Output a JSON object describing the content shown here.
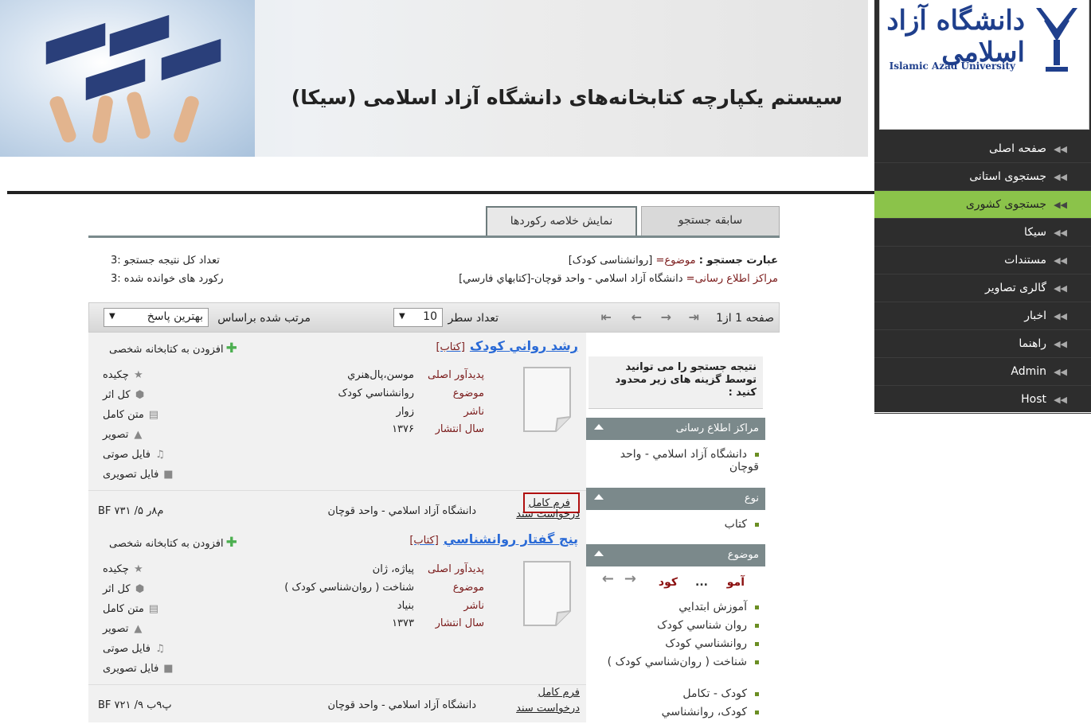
{
  "banner": {
    "title": "سیستم یکپارچه کتابخانه‌های دانشگاه آزاد اسلامی (سیکا)"
  },
  "logo": {
    "name_fa": "دانشگاه آزاد اسلامی",
    "name_en": "Islamic Azad University"
  },
  "menu": [
    {
      "label": "صفحه اصلی"
    },
    {
      "label": "جستجوی استانی"
    },
    {
      "label": "جستجوی کشوری"
    },
    {
      "label": "سیکا"
    },
    {
      "label": "مستندات"
    },
    {
      "label": "گالری تصاویر"
    },
    {
      "label": "اخبار"
    },
    {
      "label": "راهنما"
    },
    {
      "label": "Admin"
    },
    {
      "label": "Host"
    }
  ],
  "tabs": {
    "history": "سابقه جستجو",
    "summary": "نمایش خلاصه رکوردها"
  },
  "search_info": {
    "phrase_label": "عبارت جستجو :",
    "subject_label": "موضوع=",
    "subject_value": "[روانشناسی کودک]",
    "centers_label": "مراکز اطلاع رسانی=",
    "centers_value": "دانشگاه آزاد اسلامي - واحد قوچان-[کتابهاي فارسي]",
    "total_label": "تعداد کل نتیجه جستجو :",
    "total_value": "3",
    "read_label": "رکورد های خوانده شده :",
    "read_value": "3"
  },
  "toolbar": {
    "page_label": "صفحه 1 از1",
    "rows_label": "تعداد سطر",
    "rows_value": "10",
    "sort_label": "مرتب شده براساس",
    "sort_value": "بهترین پاسخ"
  },
  "field_labels": {
    "author": "پدیدآور اصلی",
    "subject": "موضوع",
    "publisher": "ناشر",
    "year": "سال انتشار"
  },
  "options": [
    "چکیده",
    "کل اثر",
    "متن کامل",
    "تصویر",
    "فایل صوتی",
    "فایل تصویری"
  ],
  "add_lib": "افزودن به کتابخانه شخصی",
  "full_form": "فرم کامل",
  "request_doc": "درخواست سند",
  "records": [
    {
      "title": "رشد رواني کودک",
      "type": "[کتاب]",
      "author": "موسن،پال‌هنري",
      "subject": "روانشناسي کودک",
      "publisher": "زوار",
      "year": "۱۳۷۶",
      "location": "دانشگاه آزاد اسلامي - واحد قوچان",
      "callno": "BF ۷۳۱ /م۸ر ۵"
    },
    {
      "title": "پنج گفتار روانشناسي",
      "type": "[کتاب]",
      "author": "پياژه، ژان",
      "subject": "شناخت ( روان‌شناسي کودک )",
      "publisher": "بنیاد",
      "year": "۱۳۷۳",
      "location": "دانشگاه آزاد اسلامي - واحد قوچان",
      "callno": "BF ۷۲۱ /پ۹ب ۹"
    }
  ],
  "facets": {
    "note": "نتیجه جستجو را می توانید توسط گزینه های زیر محدود کنید :",
    "centers_title": "مراکز اطلاع رسانی",
    "centers_item": "دانشگاه آزاد اسلامي - واحد قوچان",
    "type_title": "نوع",
    "type_item": "کتاب",
    "subject_title": "موضوع",
    "subject_nav": {
      "a": "آمو",
      "dots": "...",
      "b": "کود"
    },
    "subject_items": [
      "آموزش ابتدايي",
      "روان شناسي کودک",
      "روانشناسي کودک",
      "شناخت ( روان‌شناسي کودک )",
      "کودک - تکامل",
      "کودک، روانشناسي"
    ]
  }
}
